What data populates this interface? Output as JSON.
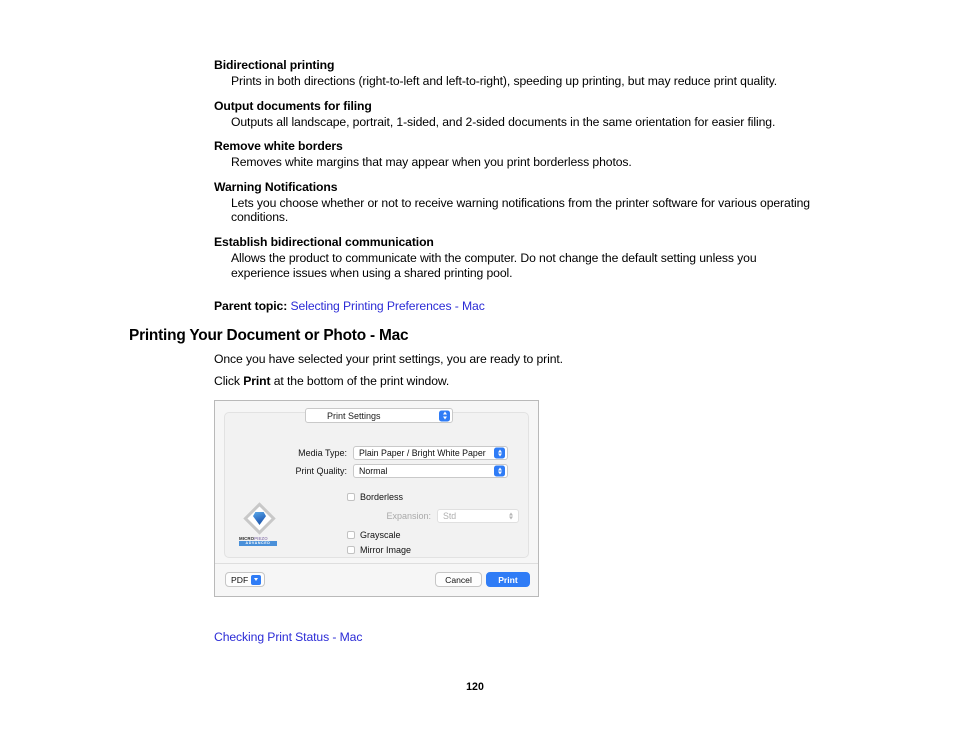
{
  "definitions": [
    {
      "term": "Bidirectional printing",
      "description": "Prints in both directions (right-to-left and left-to-right), speeding up printing, but may reduce print quality."
    },
    {
      "term": "Output documents for filing",
      "description": "Outputs all landscape, portrait, 1-sided, and 2-sided documents in the same orientation for easier filing."
    },
    {
      "term": "Remove white borders",
      "description": "Removes white margins that may appear when you print borderless photos."
    },
    {
      "term": "Warning Notifications",
      "description": "Lets you choose whether or not to receive warning notifications from the printer software for various operating conditions."
    },
    {
      "term": "Establish bidirectional communication",
      "description": "Allows the product to communicate with the computer. Do not change the default setting unless you experience issues when using a shared printing pool."
    }
  ],
  "parent_topic": {
    "label": "Parent topic:",
    "link_text": "Selecting Printing Preferences - Mac"
  },
  "section": {
    "heading": "Printing Your Document or Photo - Mac",
    "paragraph_1": "Once you have selected your print settings, you are ready to print.",
    "paragraph_2_prefix": "Click ",
    "paragraph_2_bold": "Print",
    "paragraph_2_suffix": " at the bottom of the print window."
  },
  "dialog": {
    "panel_popup": {
      "value": "Print Settings",
      "stepper_icon": "up-down-chevron-icon"
    },
    "fields": [
      {
        "label": "Media Type:",
        "value": "Plain Paper / Bright White Paper"
      },
      {
        "label": "Print Quality:",
        "value": "Normal"
      }
    ],
    "checkboxes": [
      {
        "label": "Borderless",
        "checked": false
      },
      {
        "label": "Grayscale",
        "checked": false
      },
      {
        "label": "Mirror Image",
        "checked": false
      }
    ],
    "expansion": {
      "label": "Expansion:",
      "value": "Std",
      "disabled": true
    },
    "logo": {
      "name": "micro-piezo-logo",
      "text_micro": "MICRO",
      "text_piezo": "PIEZO",
      "badge": "ADVANCED"
    },
    "footer": {
      "pdf_button": "PDF",
      "cancel_button": "Cancel",
      "print_button": "Print"
    }
  },
  "bottom_link": "Checking Print Status - Mac",
  "page_number": "120",
  "colors": {
    "link": "#2b2bd6",
    "accent_blue": "#2f7cf6",
    "dialog_bg": "#f6f6f6"
  }
}
